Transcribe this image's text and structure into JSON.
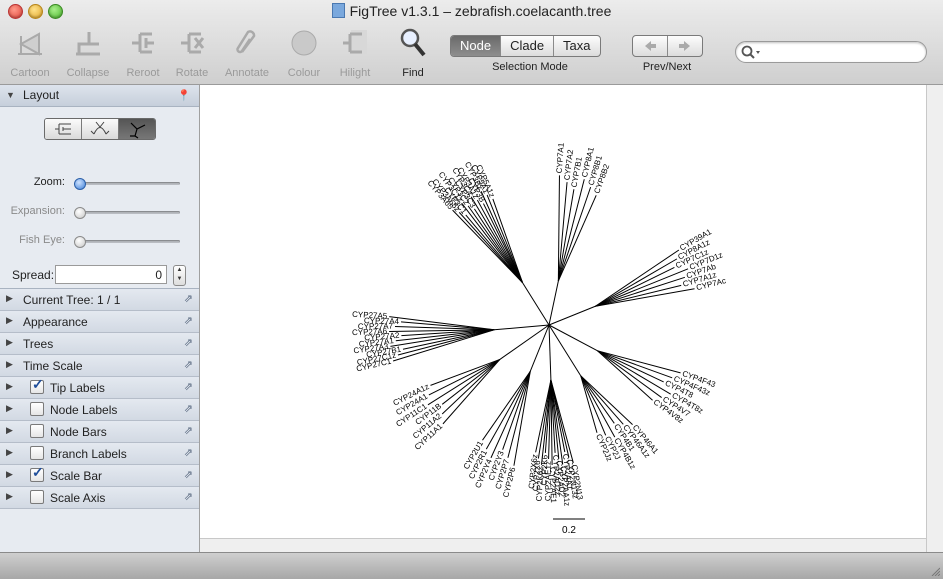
{
  "window": {
    "title": "FigTree v1.3.1 – zebrafish.coelacanth.tree"
  },
  "toolbar": {
    "tools": [
      {
        "name": "cartoon",
        "label": "Cartoon"
      },
      {
        "name": "collapse",
        "label": "Collapse"
      },
      {
        "name": "reroot",
        "label": "Reroot"
      },
      {
        "name": "rotate",
        "label": "Rotate"
      },
      {
        "name": "annotate",
        "label": "Annotate"
      },
      {
        "name": "colour",
        "label": "Colour"
      },
      {
        "name": "hilight",
        "label": "Hilight"
      },
      {
        "name": "find",
        "label": "Find"
      }
    ],
    "selection_mode": {
      "caption": "Selection Mode",
      "options": [
        "Node",
        "Clade",
        "Taxa"
      ],
      "selected": "Node"
    },
    "prev_next": {
      "caption": "Prev/Next"
    },
    "search": {
      "placeholder": "",
      "value": ""
    }
  },
  "sidebar": {
    "layout": {
      "title": "Layout",
      "zoom_label": "Zoom:",
      "expansion_label": "Expansion:",
      "fisheye_label": "Fish Eye:",
      "spread_label": "Spread:",
      "spread_value": "0"
    },
    "panels": [
      {
        "label": "Current Tree: 1 / 1",
        "checkbox": null
      },
      {
        "label": "Appearance",
        "checkbox": null
      },
      {
        "label": "Trees",
        "checkbox": null
      },
      {
        "label": "Time Scale",
        "checkbox": null
      },
      {
        "label": "Tip Labels",
        "checkbox": true
      },
      {
        "label": "Node Labels",
        "checkbox": false
      },
      {
        "label": "Node Bars",
        "checkbox": false
      },
      {
        "label": "Branch Labels",
        "checkbox": false
      },
      {
        "label": "Scale Bar",
        "checkbox": true
      },
      {
        "label": "Scale Axis",
        "checkbox": false
      }
    ]
  },
  "tree": {
    "scale_bar_label": "0.2",
    "tips": [
      "CYP7A1",
      "CYP7A2",
      "CYP7B1",
      "CYP8A1",
      "CYP8B1",
      "CYP8B2",
      "CYP39A1",
      "CYP8A1z",
      "CYP7C1z",
      "CYP7D1z",
      "CYP7Ab",
      "CYP7A1z",
      "CYP7Ac",
      "CYP4F43",
      "CYP4F43z",
      "CYP4T8",
      "CYP4T8z",
      "CYP4V7",
      "CYP4V8z",
      "CYP46A1",
      "CYP46A1z",
      "CYP4B1",
      "CYP4B1z",
      "CYP2J",
      "CYP2Jz",
      "CYP2N13",
      "CYP2N13z",
      "CYP2AA1",
      "CYP2AA1z",
      "CYP2AD2",
      "CYP2AD2z",
      "CYP2AE1",
      "CYP2AE1z",
      "CYP2K6",
      "CYP2K6z",
      "CYP2X6",
      "CYP2X6z",
      "CYP11A1",
      "CYP11A2",
      "CYP11B",
      "CYP11C1",
      "CYP24A1",
      "CYP24A1z",
      "CYP27C1",
      "CYP27C1z",
      "CYP27B1",
      "CYP27A3",
      "CYP27A1",
      "CYP27A2",
      "CYP27A6",
      "CYP27A7",
      "CYP27A4",
      "CYP27A5",
      "CYP3A65",
      "CYP3A65z",
      "CYP3C1",
      "CYP3C1z",
      "CYP3C2",
      "CYP3C3",
      "CYP3C4",
      "CYP3A1z",
      "CYP3B",
      "CYP3Bz",
      "CYP5A1",
      "CYP5A1z",
      "CYP2P6",
      "CYP2P7",
      "CYP2Y3",
      "CYP2Y4",
      "CYP2R1",
      "CYP2U1"
    ]
  },
  "colors": {
    "selected_segment": "#777777",
    "checkbox_tick": "#1f4e9a",
    "tree_line": "#000000"
  }
}
